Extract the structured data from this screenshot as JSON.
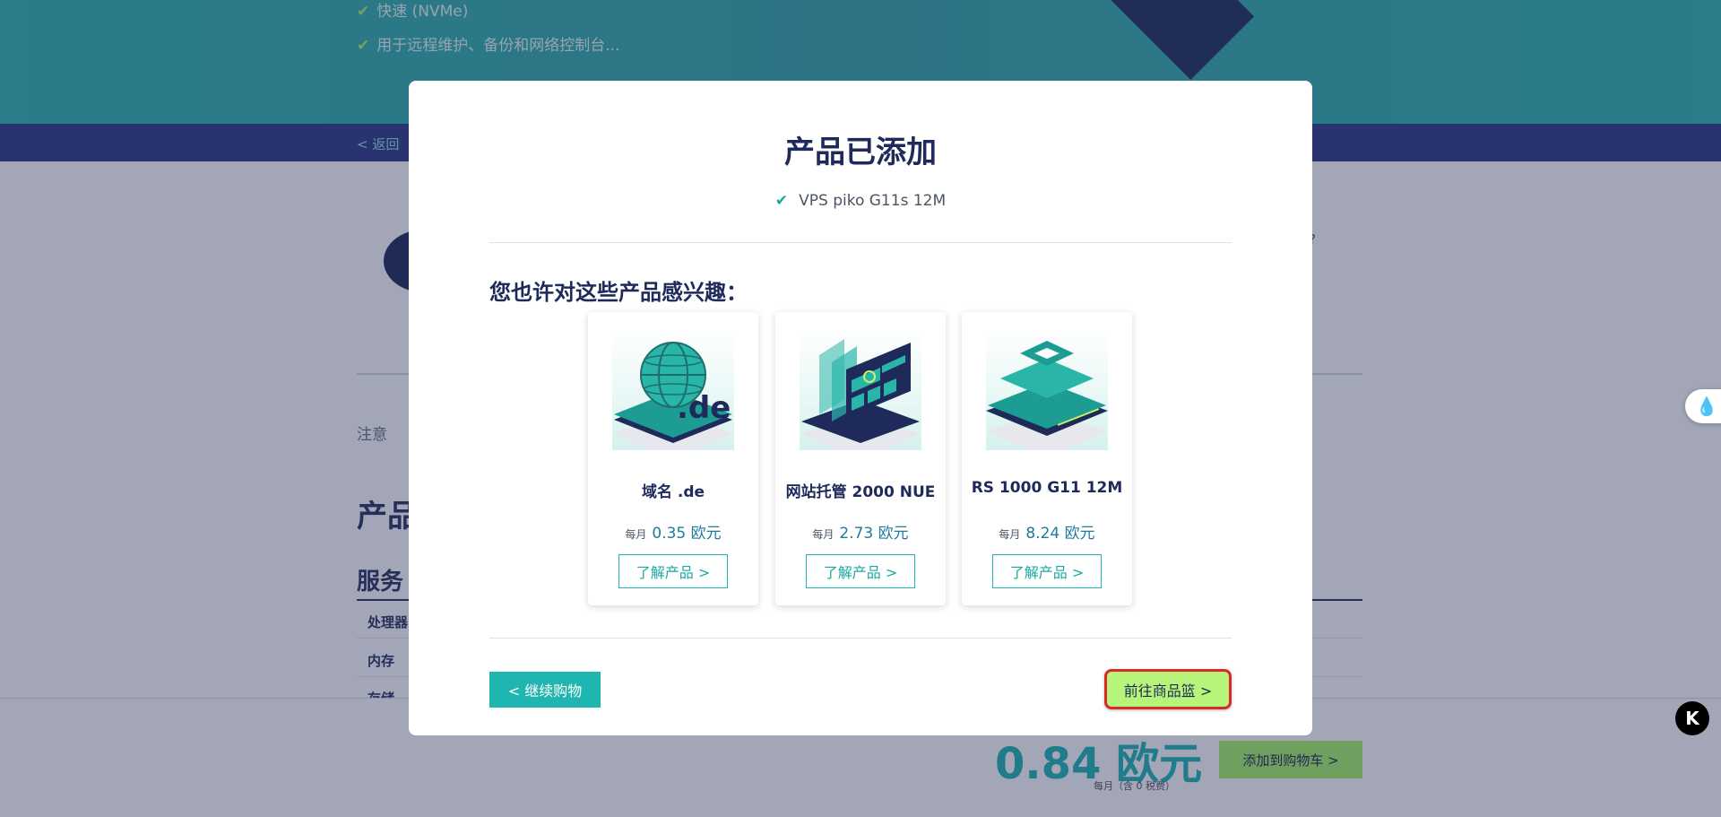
{
  "background": {
    "hero_items": [
      "快速 (NVMe)",
      "用于远程维护、备份和网络控制台..."
    ],
    "nav_link": "< 返回",
    "note": "注意",
    "heading_product": "产品",
    "heading_service": "服务",
    "rows": [
      "处理器",
      "内存",
      "存储"
    ],
    "question": "?",
    "footer": {
      "price": "0.84 欧元",
      "price_sub": "每月（含 0 税费）",
      "add_to_cart": "添加到购物车 >"
    }
  },
  "modal": {
    "title": "产品已添加",
    "added_item": "VPS piko G11s 12M",
    "suggest_title": "您也许对这些产品感兴趣：",
    "cards": [
      {
        "name": "域名 .de",
        "period": "每月",
        "price": "0.35 欧元",
        "button": "了解产品 >",
        "icon": "globe-de-icon"
      },
      {
        "name": "网站托管 2000 NUE",
        "period": "每月",
        "price": "2.73 欧元",
        "button": "了解产品 >",
        "icon": "webhosting-icon"
      },
      {
        "name": "RS 1000 G11 12M",
        "period": "每月",
        "price": "8.24 欧元",
        "button": "了解产品 >",
        "icon": "root-server-icon"
      }
    ],
    "continue_button": "< 继续购物",
    "basket_button": "前往商品篮 >"
  },
  "widgets": {
    "k_badge": "K"
  },
  "colors": {
    "accent": "#1fb5b0",
    "navy": "#1e2a5a",
    "lime": "#b7f57a",
    "highlight": "#d62b2b"
  }
}
